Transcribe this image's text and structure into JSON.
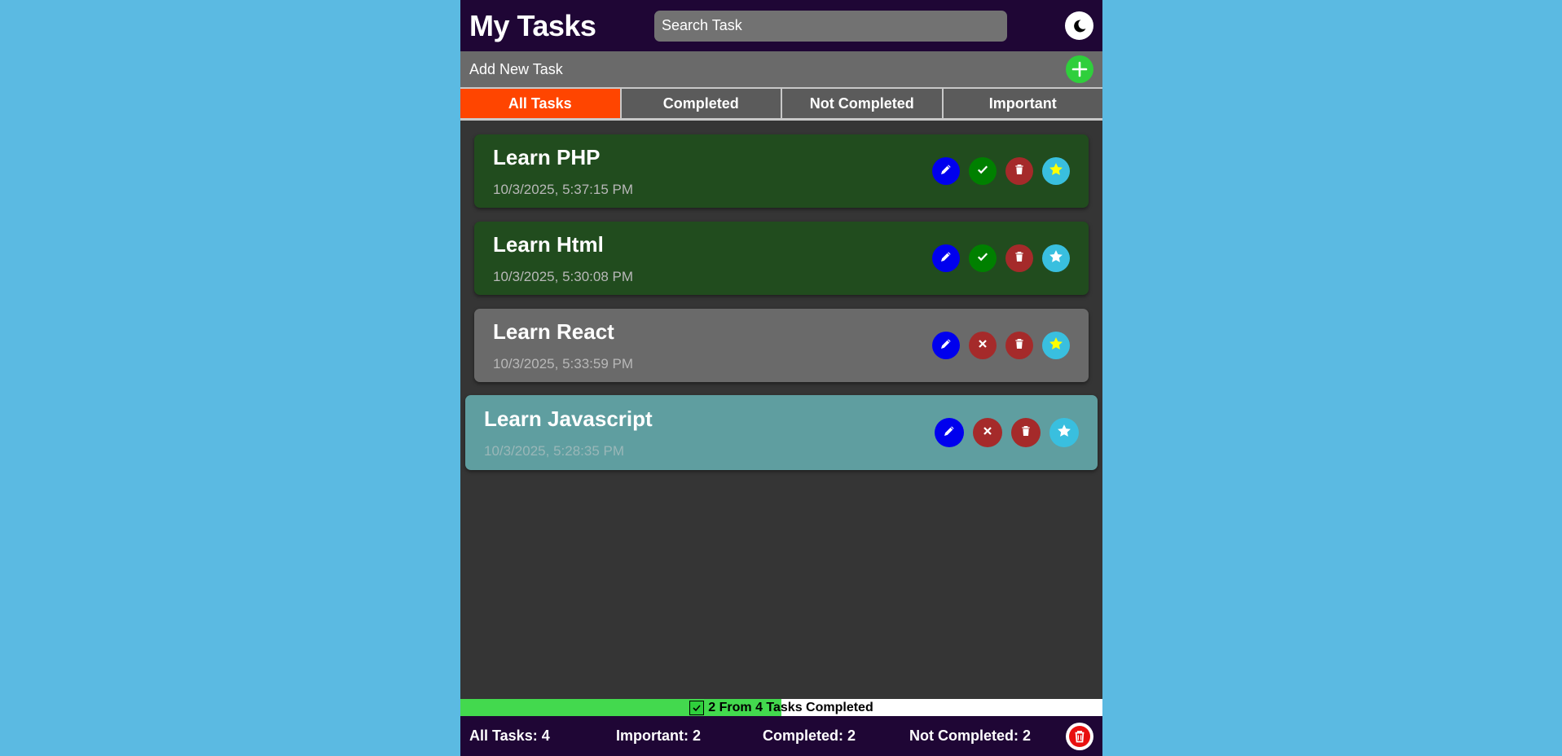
{
  "header": {
    "title": "My Tasks",
    "search_placeholder": "Search Task",
    "theme_icon": "moon-icon"
  },
  "add_bar": {
    "label": "Add New Task",
    "icon": "plus-icon"
  },
  "tabs": [
    {
      "label": "All Tasks",
      "active": true
    },
    {
      "label": "Completed",
      "active": false
    },
    {
      "label": "Not Completed",
      "active": false
    },
    {
      "label": "Important",
      "active": false
    }
  ],
  "tasks": [
    {
      "title": "Learn PHP",
      "date": "10/3/2025, 5:37:15 PM",
      "completed": true,
      "important": true
    },
    {
      "title": "Learn Html",
      "date": "10/3/2025, 5:30:08 PM",
      "completed": true,
      "important": false
    },
    {
      "title": "Learn React",
      "date": "10/3/2025, 5:33:59 PM",
      "completed": false,
      "important": true
    },
    {
      "title": "Learn Javascript",
      "date": "10/3/2025, 5:28:35 PM",
      "completed": false,
      "important": false
    }
  ],
  "colors": {
    "completed_card": "#214c1e",
    "pending_card": "#6a6a6a",
    "hover_card": "#5f9ea0",
    "edit": "#0000ee",
    "check": "#008000",
    "uncheck": "#a52a2a",
    "delete": "#a52a2a",
    "star_bg": "#39bfdf",
    "star_on": "#ffff00",
    "star_off": "#ffffff"
  },
  "progress": {
    "completed": 2,
    "total": 4,
    "fraction": 0.5,
    "label": "2 From 4 Tasks Completed"
  },
  "stats": {
    "all": "All Tasks: 4",
    "important": "Important: 2",
    "completed": "Completed: 2",
    "not_completed": "Not Completed: 2"
  }
}
